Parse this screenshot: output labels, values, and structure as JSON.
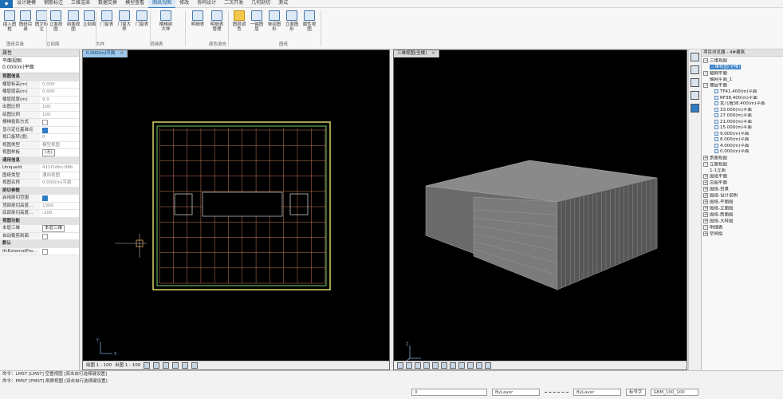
{
  "menu": [
    "设计建模",
    "钢筋标注",
    "三维渲染",
    "数据交换",
    "模型查看",
    "图纸视图",
    "修改",
    "协同设计",
    "二次开发",
    "几何剖切",
    "测试"
  ],
  "ribbon": {
    "buttons": [
      {
        "label": "插入图框"
      },
      {
        "label": "图纸目录"
      },
      {
        "label": "图文标注"
      },
      {
        "label": "立面视图"
      },
      {
        "label": "剖面视图"
      },
      {
        "label": "立剖面"
      },
      {
        "label": "门窗表"
      },
      {
        "label": "门窗大样"
      },
      {
        "label": "门窗表"
      },
      {
        "label": "楼梯剖大样"
      },
      {
        "label": "明细表"
      },
      {
        "label": "明细表管理"
      },
      {
        "label": "图层调色"
      },
      {
        "label": "一键图层"
      },
      {
        "label": "单间图形"
      },
      {
        "label": "立面图形"
      },
      {
        "label": "属性视图"
      }
    ],
    "groups": [
      "图纸目录",
      "立剖面",
      "大样",
      "明细表",
      "颜色填充",
      "图纸"
    ]
  },
  "left_panel": {
    "title": "属性",
    "view_name": "平面视图",
    "view_level": "0.000(m)平面",
    "rows": [
      {
        "type": "section",
        "label": "视图信息"
      },
      {
        "label": "楼层标高(m)",
        "value": "0.000"
      },
      {
        "label": "楼层层高(m)",
        "value": "0.000"
      },
      {
        "label": "楼层层厚(m)",
        "value": "9.0"
      },
      {
        "label": "出图比例",
        "value": "100"
      },
      {
        "label": "绘图比例",
        "value": "100"
      },
      {
        "label": "楼梯投影方式",
        "check": false
      },
      {
        "label": "显示定位基准点",
        "check": true
      },
      {
        "label": "视口旋转(度)",
        "value": "0"
      },
      {
        "label": "视图类型",
        "value": "模型视图"
      },
      {
        "label": "视图样板",
        "select": "(无)"
      },
      {
        "type": "section",
        "label": "通用信息"
      },
      {
        "label": "UniqueId",
        "value": "411f1dbc-98b"
      },
      {
        "label": "图纸类型",
        "value": "通用视图"
      },
      {
        "label": "视图名称",
        "value": "0.000(m)平面"
      },
      {
        "type": "section",
        "label": "剖切参数"
      },
      {
        "label": "启用剖切范围",
        "check": true
      },
      {
        "label": "顶部剖切高度...",
        "value": "1300"
      },
      {
        "label": "底部剖切高度...",
        "value": "-200"
      },
      {
        "type": "section",
        "label": "视图功能"
      },
      {
        "label": "本层三维",
        "select": "本层三维"
      },
      {
        "label": "自动裁剪剖面",
        "check": false
      },
      {
        "type": "section",
        "label": "默认"
      },
      {
        "label": "IfcExternalPro...",
        "check": false
      }
    ]
  },
  "plan_view": {
    "tab_label": "0.000(m)平面",
    "scale_label": "绘图 1 : 100",
    "scale_label2": "出图 1 : 100"
  },
  "view3d": {
    "tab_label": "三维视图(全楼)"
  },
  "right_panel": {
    "title": "项目浏览器 - 4#建筑",
    "tree": [
      {
        "lvl": 1,
        "sign": "−",
        "text": "三维视图"
      },
      {
        "lvl": 2,
        "text": "三维视图(全楼)",
        "selected": true
      },
      {
        "lvl": 1,
        "sign": "−",
        "text": "轴网平面"
      },
      {
        "lvl": 2,
        "text": "轴网平面_1"
      },
      {
        "lvl": 1,
        "sign": "−",
        "text": "楼层平面"
      },
      {
        "lvl": 3,
        "text": "TF41.400(m)平面"
      },
      {
        "lvl": 3,
        "text": "RF38.400(m)平面"
      },
      {
        "lvl": 3,
        "text": "女儿墙38.400(m)平面"
      },
      {
        "lvl": 3,
        "text": "33.000(m)平面"
      },
      {
        "lvl": 3,
        "text": "27.000(m)平面"
      },
      {
        "lvl": 3,
        "text": "21.000(m)平面"
      },
      {
        "lvl": 3,
        "text": "15.000(m)平面"
      },
      {
        "lvl": 3,
        "text": "9.000(m)平面"
      },
      {
        "lvl": 3,
        "text": "8.000(m)平面"
      },
      {
        "lvl": 3,
        "text": "4.000(m)平面"
      },
      {
        "lvl": 3,
        "text": "0.000(m)平面"
      },
      {
        "lvl": 1,
        "sign": "+",
        "text": "剖面视图"
      },
      {
        "lvl": 1,
        "sign": "−",
        "text": "立面视图"
      },
      {
        "lvl": 2,
        "text": "1-1立面"
      },
      {
        "lvl": 1,
        "sign": "+",
        "text": "图纸平面"
      },
      {
        "lvl": 1,
        "sign": "+",
        "text": "总图平面"
      },
      {
        "lvl": 1,
        "sign": "+",
        "text": "图纸-目录"
      },
      {
        "lvl": 1,
        "sign": "+",
        "text": "图纸-设计说明"
      },
      {
        "lvl": 1,
        "sign": "+",
        "text": "图纸-平面图"
      },
      {
        "lvl": 1,
        "sign": "+",
        "text": "图纸-立面图"
      },
      {
        "lvl": 1,
        "sign": "+",
        "text": "图纸-剖面图"
      },
      {
        "lvl": 1,
        "sign": "+",
        "text": "图纸-大样图"
      },
      {
        "lvl": 1,
        "sign": "−",
        "text": "明细表"
      },
      {
        "lvl": 1,
        "sign": "+",
        "text": "空间组"
      }
    ]
  },
  "status": {
    "cmd1": "命令：LMST [LMST] 空置视图 [双击自行选择键设置]",
    "cmd2": "命令：PMST [PMST] 刷屏视图 [双击自行选择键设置]",
    "layer": "0",
    "bylayer1": "ByLayer",
    "bylayer2": "ByLayer",
    "font": "标号字",
    "style": "GBM_100_100"
  }
}
